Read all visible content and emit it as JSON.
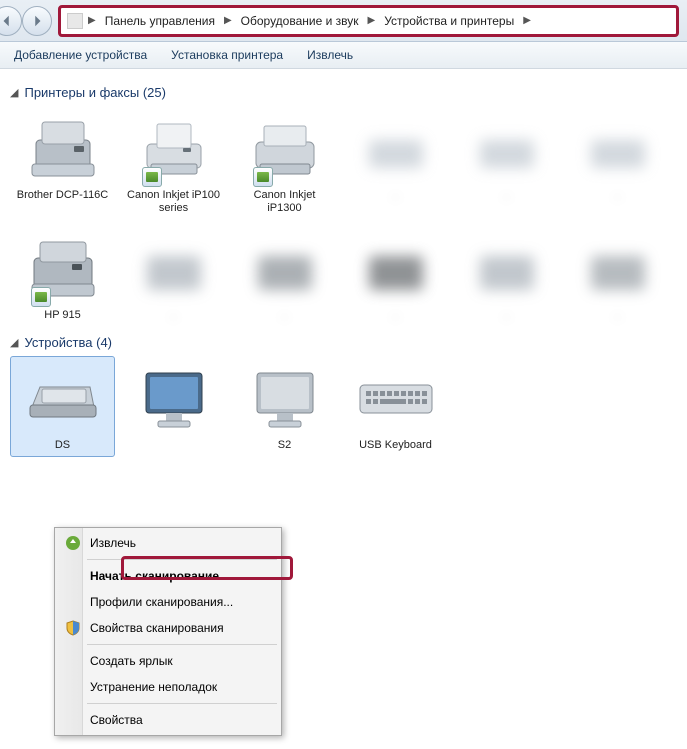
{
  "breadcrumb": {
    "items": [
      "Панель управления",
      "Оборудование и звук",
      "Устройства и принтеры"
    ]
  },
  "toolbar": {
    "add_device": "Добавление устройства",
    "add_printer": "Установка принтера",
    "eject": "Извлечь"
  },
  "sections": {
    "printers": {
      "title": "Принтеры и факсы",
      "count": "(25)"
    },
    "devices": {
      "title": "Устройства",
      "count": "(4)"
    }
  },
  "printers": [
    {
      "label": "Brother DCP-116C"
    },
    {
      "label": "Canon Inkjet iP100 series"
    },
    {
      "label": "Canon Inkjet iP1300"
    },
    {
      "label": "HP 915"
    }
  ],
  "devices": [
    {
      "label": "DS"
    },
    {
      "label": ""
    },
    {
      "label": "S2"
    },
    {
      "label": "USB Keyboard"
    }
  ],
  "context_menu": {
    "eject": "Извлечь",
    "start_scan": "Начать сканирование",
    "scan_profiles": "Профили сканирования...",
    "scan_props": "Свойства сканирования",
    "create_shortcut": "Создать ярлык",
    "troubleshoot": "Устранение неполадок",
    "properties": "Свойства"
  }
}
